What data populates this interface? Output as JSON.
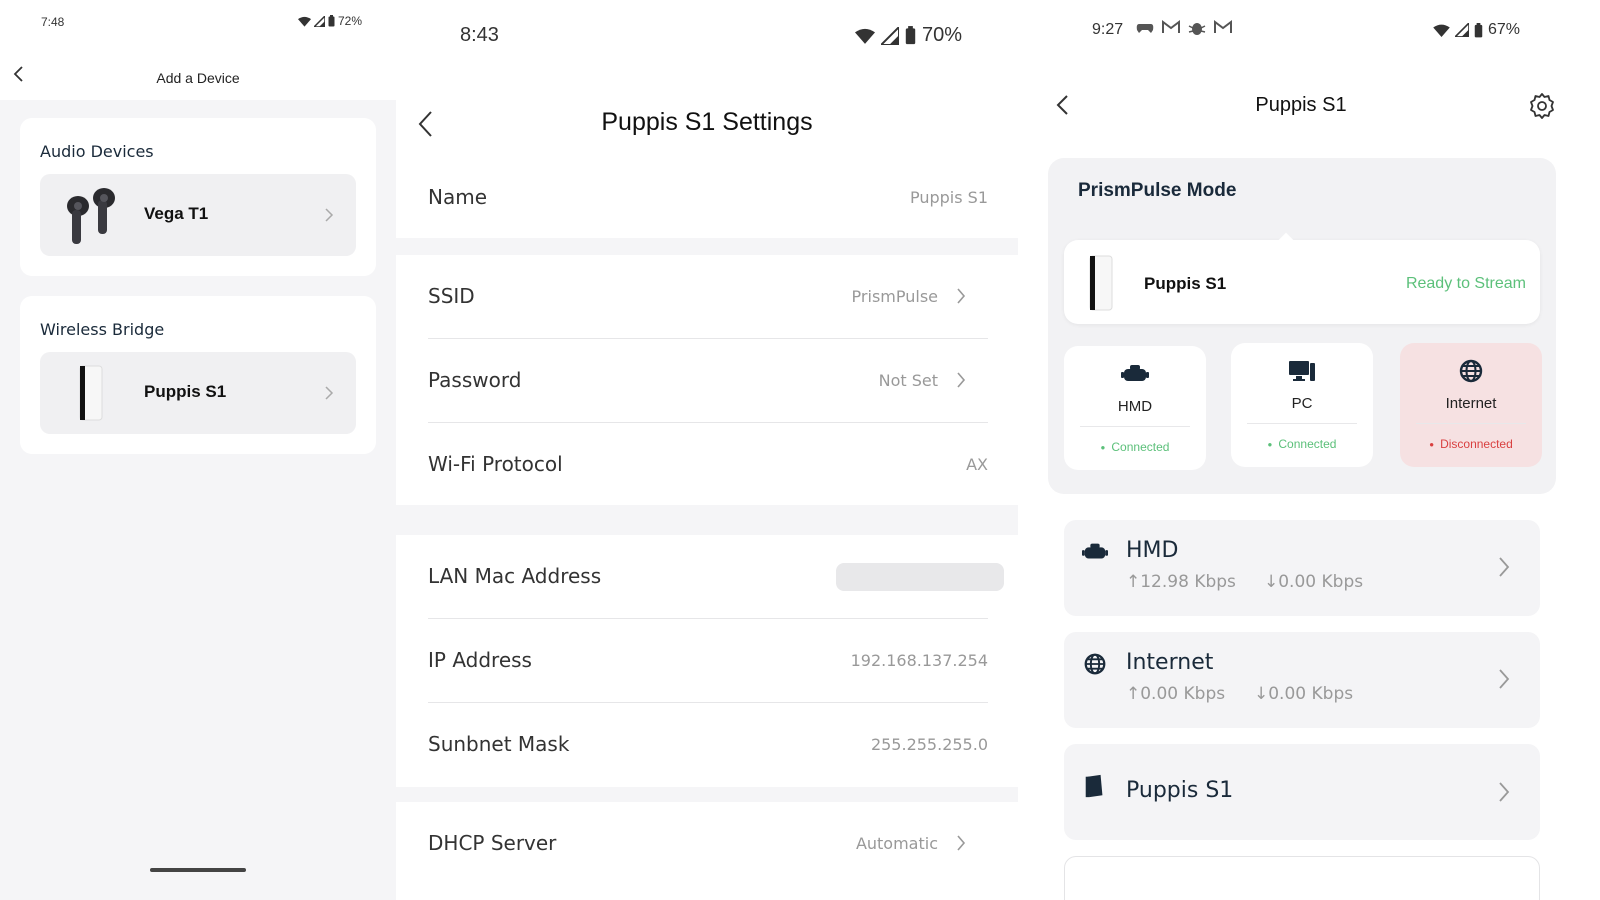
{
  "panel1": {
    "status": {
      "time": "7:48",
      "battery": "72%"
    },
    "header": {
      "title": "Add a Device"
    },
    "sections": [
      {
        "title": "Audio Devices",
        "item": "Vega T1",
        "icon": "earbuds-image"
      },
      {
        "title": "Wireless Bridge",
        "item": "Puppis S1",
        "icon": "bridge-device-image"
      }
    ]
  },
  "panel2": {
    "status": {
      "time": "8:43",
      "battery": "70%"
    },
    "header": {
      "title": "Puppis S1 Settings"
    },
    "rows": {
      "name": {
        "label": "Name",
        "value": "Puppis S1"
      },
      "ssid": {
        "label": "SSID",
        "value": "PrismPulse"
      },
      "password": {
        "label": "Password",
        "value": "Not Set"
      },
      "protocol": {
        "label": "Wi-Fi Protocol",
        "value": "AX"
      },
      "lan_mac": {
        "label": "LAN Mac Address",
        "value": ""
      },
      "ip": {
        "label": "IP Address",
        "value": "192.168.137.254"
      },
      "subnet": {
        "label": "Sunbnet Mask",
        "value": "255.255.255.0"
      },
      "dhcp": {
        "label": "DHCP Server",
        "value": "Automatic"
      }
    }
  },
  "panel3": {
    "status": {
      "time": "9:27",
      "battery": "67%"
    },
    "header": {
      "title": "Puppis S1"
    },
    "mode": {
      "title": "PrismPulse Mode",
      "device_name": "Puppis S1",
      "device_status": "Ready to Stream",
      "tiles": [
        {
          "name": "HMD",
          "status": "Connected",
          "icon": "headset-icon"
        },
        {
          "name": "PC",
          "status": "Connected",
          "icon": "pc-icon"
        },
        {
          "name": "Internet",
          "status": "Disconnected",
          "icon": "globe-icon"
        }
      ]
    },
    "list": [
      {
        "name": "HMD",
        "up": "↑12.98 Kbps",
        "down": "↓0.00 Kbps",
        "icon": "headset-icon"
      },
      {
        "name": "Internet",
        "up": "↑0.00 Kbps",
        "down": "↓0.00 Kbps",
        "icon": "globe-icon"
      },
      {
        "name": "Puppis S1",
        "icon": "bridge-device-icon"
      }
    ]
  },
  "colors": {
    "connected": "#5cc07a",
    "disconnected": "#d94040",
    "disconnected_bg": "#f6e1e2"
  }
}
